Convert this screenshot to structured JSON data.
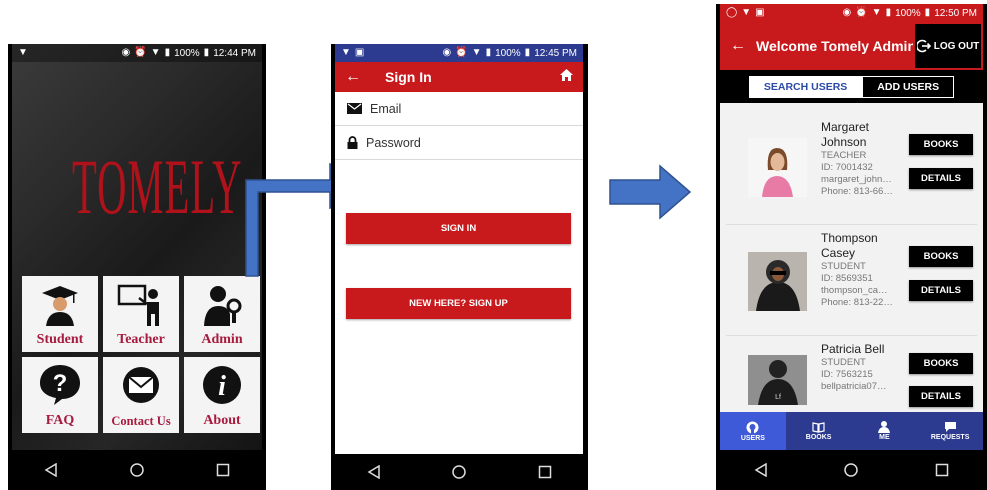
{
  "colors": {
    "brand_red": "#c81a1d",
    "nav_blue": "#2c3a8f",
    "accent_blue": "#3e5ad8",
    "logo_red": "#b0121b",
    "tile_label": "#a81a3e"
  },
  "phone1": {
    "status": {
      "battery": "100%",
      "time": "12:44 PM"
    },
    "logo": "TOMELY",
    "menu": [
      {
        "label": "Student",
        "icon": "student-graduate-icon"
      },
      {
        "label": "Teacher",
        "icon": "teacher-board-icon"
      },
      {
        "label": "Admin",
        "icon": "admin-key-icon"
      },
      {
        "label": "FAQ",
        "icon": "question-mark-icon"
      },
      {
        "label": "Contact Us",
        "icon": "envelope-icon"
      },
      {
        "label": "About",
        "icon": "info-icon"
      }
    ]
  },
  "phone2": {
    "status": {
      "battery": "100%",
      "time": "12:45 PM"
    },
    "title": "Sign In",
    "email_placeholder": "Email",
    "password_placeholder": "Password",
    "sign_in_label": "SIGN IN",
    "sign_up_label": "NEW HERE? SIGN UP"
  },
  "phone3": {
    "status": {
      "battery": "100%",
      "time": "12:50 PM"
    },
    "title": "Welcome Tomely Admin",
    "logout_label": "LOG OUT",
    "tabs": {
      "search": "SEARCH USERS",
      "add": "ADD USERS"
    },
    "users": [
      {
        "name_line1": "Margaret",
        "name_line2": "Johnson",
        "role": "TEACHER",
        "id": "ID: 7001432",
        "email": "margaret_john…",
        "phone": "Phone: 813-66…",
        "books_label": "BOOKS",
        "details_label": "DETAILS"
      },
      {
        "name_line1": "Thompson",
        "name_line2": "Casey",
        "role": "STUDENT",
        "id": "ID: 8569351",
        "email": "thompson_ca…",
        "phone": "Phone: 813-22…",
        "books_label": "BOOKS",
        "details_label": "DETAILS"
      },
      {
        "name_line1": "Patricia  Bell",
        "name_line2": "",
        "role": "STUDENT",
        "id": "ID: 7563215",
        "email": "bellpatricia07…",
        "phone": "",
        "books_label": "BOOKS",
        "details_label": "DETAILS"
      }
    ],
    "bottom_nav": [
      {
        "label": "USERS",
        "icon": "github-users-icon"
      },
      {
        "label": "BOOKS",
        "icon": "book-icon"
      },
      {
        "label": "ME",
        "icon": "person-icon"
      },
      {
        "label": "REQUESTS",
        "icon": "chat-icon"
      }
    ]
  }
}
